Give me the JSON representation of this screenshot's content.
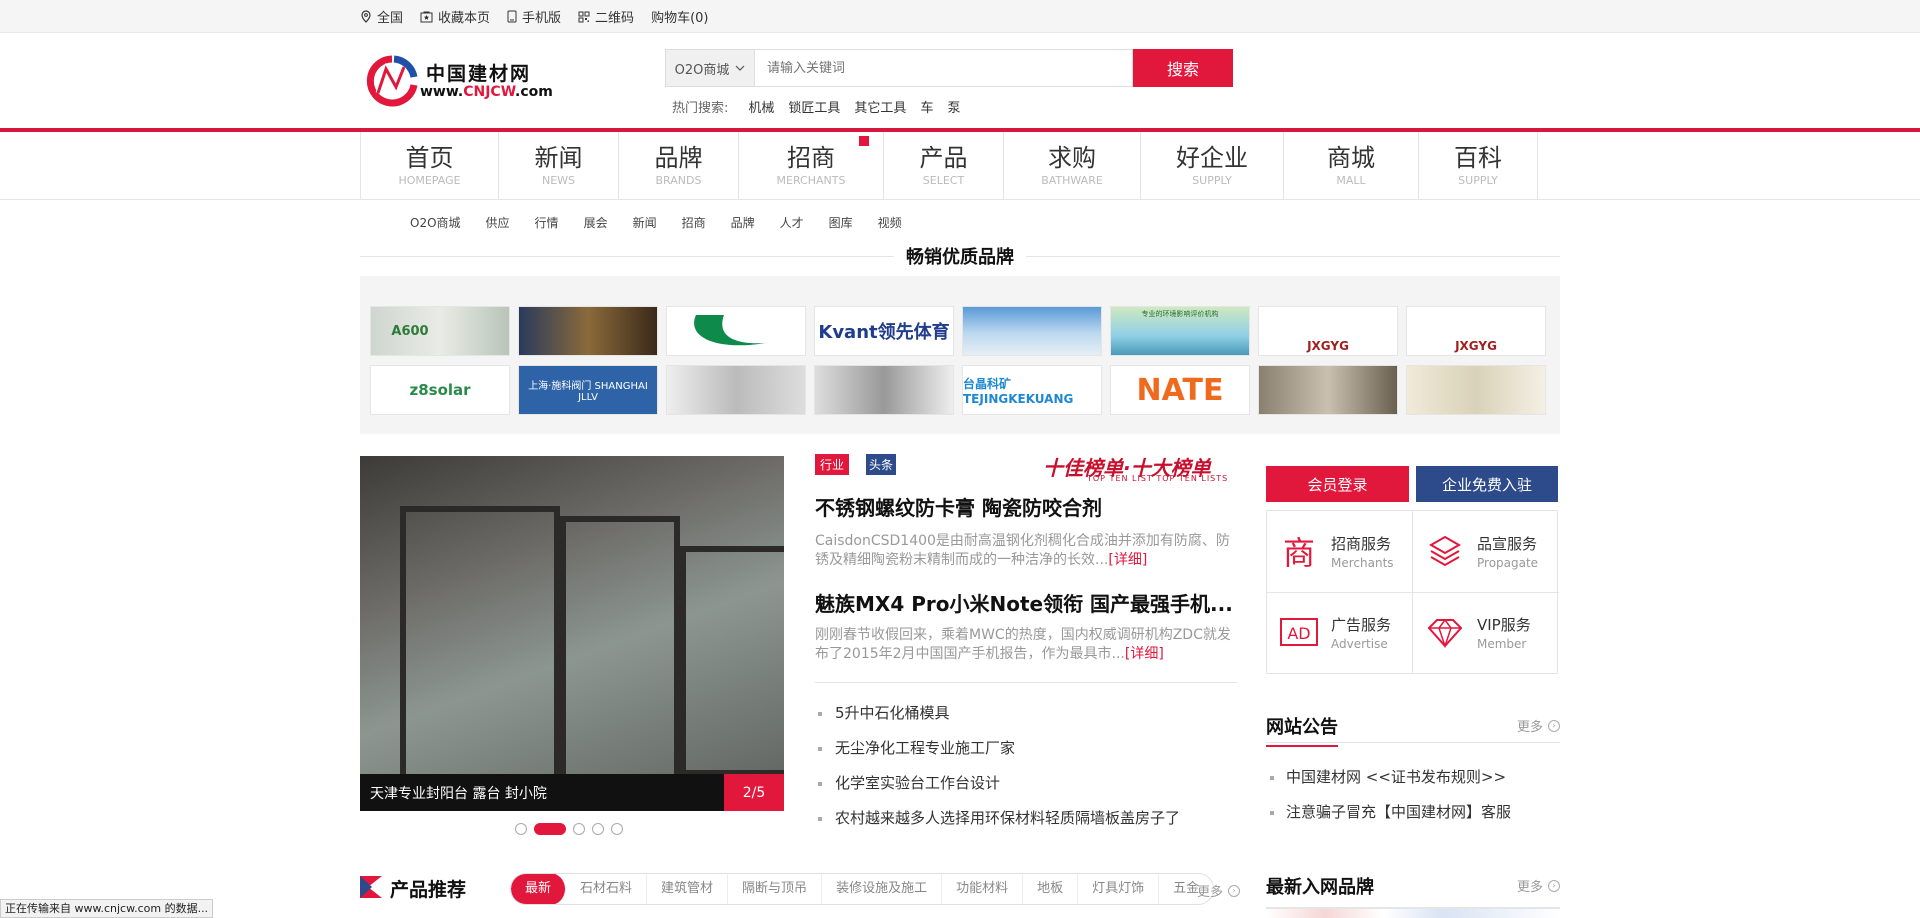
{
  "topbar": {
    "items": [
      {
        "label": "全国",
        "icon": "location-pin-icon"
      },
      {
        "label": "收藏本页",
        "icon": "bookmark-icon"
      },
      {
        "label": "手机版",
        "icon": "mobile-phone-icon"
      },
      {
        "label": "二维码",
        "icon": "qr-code-icon"
      },
      {
        "label": "购物车(0)",
        "icon": ""
      }
    ]
  },
  "header": {
    "logo_name": "中国建材网",
    "logo_url_prefix": "www.",
    "logo_url_brand": "CNJCW",
    "logo_url_suffix": ".com",
    "search_category": "O2O商城",
    "search_placeholder": "请输入关键词",
    "search_button": "搜索",
    "hot_label": "热门搜索:",
    "hot_terms": [
      "机械",
      "锁匠工具",
      "其它工具",
      "车",
      "泵"
    ]
  },
  "nav": [
    {
      "cn": "首页",
      "en": "HOMEPAGE"
    },
    {
      "cn": "新闻",
      "en": "NEWS"
    },
    {
      "cn": "品牌",
      "en": "BRANDS"
    },
    {
      "cn": "招商",
      "en": "MERCHANTS"
    },
    {
      "cn": "产品",
      "en": "SELECT"
    },
    {
      "cn": "求购",
      "en": "BATHWARE"
    },
    {
      "cn": "好企业",
      "en": "SUPPLY"
    },
    {
      "cn": "商城",
      "en": "MALL"
    },
    {
      "cn": "百科",
      "en": "SUPPLY"
    }
  ],
  "subnav": [
    "O2O商城",
    "供应",
    "行情",
    "展会",
    "新闻",
    "招商",
    "品牌",
    "人才",
    "图库",
    "视频"
  ],
  "brands": {
    "title": "畅销优质品牌",
    "logos": [
      "A600",
      "",
      "",
      "Kvant领先体育",
      "",
      "专业的环境影响评价机构",
      "JXGYG",
      "JXGYG",
      "z8solar",
      "上海·施科阀门 SHANGHAI JLLV",
      "",
      "",
      "台晶科矿 TEJINGKEKUANG",
      "NATE",
      "",
      ""
    ]
  },
  "slider": {
    "caption": "天津专业封阳台 露台 封小院",
    "page": "2/5",
    "dots": 5,
    "active_dot": 2
  },
  "news": {
    "tag": "行业",
    "tag2": "头条",
    "banner": "十佳榜单·十大榜单",
    "banner_sub": "TOP TEN LIST  TOP TEN LISTS",
    "headline1": "不锈钢螺纹防卡膏 陶瓷防咬合剂",
    "summary1": "CaisdonCSD1400是由耐高温钢化剂稠化合成油并添加有防腐、防锈及精细陶瓷粉末精制而成的一种洁净的长效...",
    "more1": "[详细]",
    "headline2": "魅族MX4 Pro小米Note领衔 国产最强手机...",
    "summary2": "刚刚春节收假回来，乘着MWC的热度，国内权威调研机构ZDC就发布了2015年2月中国国产手机报告，作为最具市...",
    "more2": "[详细]",
    "list": [
      "5升中石化桶模具",
      "无尘净化工程专业施工厂家",
      "化学室实验台工作台设计",
      "农村越来越多人选择用环保材料轻质隔墙板盖房子了"
    ]
  },
  "side": {
    "login": "会员登录",
    "join": "企业免费入驻",
    "services": [
      {
        "cn": "招商服务",
        "en": "Merchants",
        "icon": "merchant-char-icon"
      },
      {
        "cn": "品宣服务",
        "en": "Propagate",
        "icon": "layers-icon"
      },
      {
        "cn": "广告服务",
        "en": "Advertise",
        "icon": "ad-icon"
      },
      {
        "cn": "VIP服务",
        "en": "Member",
        "icon": "diamond-icon"
      }
    ]
  },
  "notice": {
    "title": "网站公告",
    "more": "更多",
    "items": [
      "中国建材网 <<证书发布规则>>",
      "注意骗子冒充【中国建材网】客服"
    ]
  },
  "products": {
    "title": "产品推荐",
    "tabs": [
      "最新",
      "石材石料",
      "建筑管材",
      "隔断与顶吊",
      "装修设施及施工",
      "功能材料",
      "地板",
      "灯具灯饰",
      "五金"
    ],
    "more": "更多"
  },
  "newbrands": {
    "title": "最新入网品牌",
    "more": "更多"
  },
  "status": "正在传输来自 www.cnjcw.com 的数据..."
}
